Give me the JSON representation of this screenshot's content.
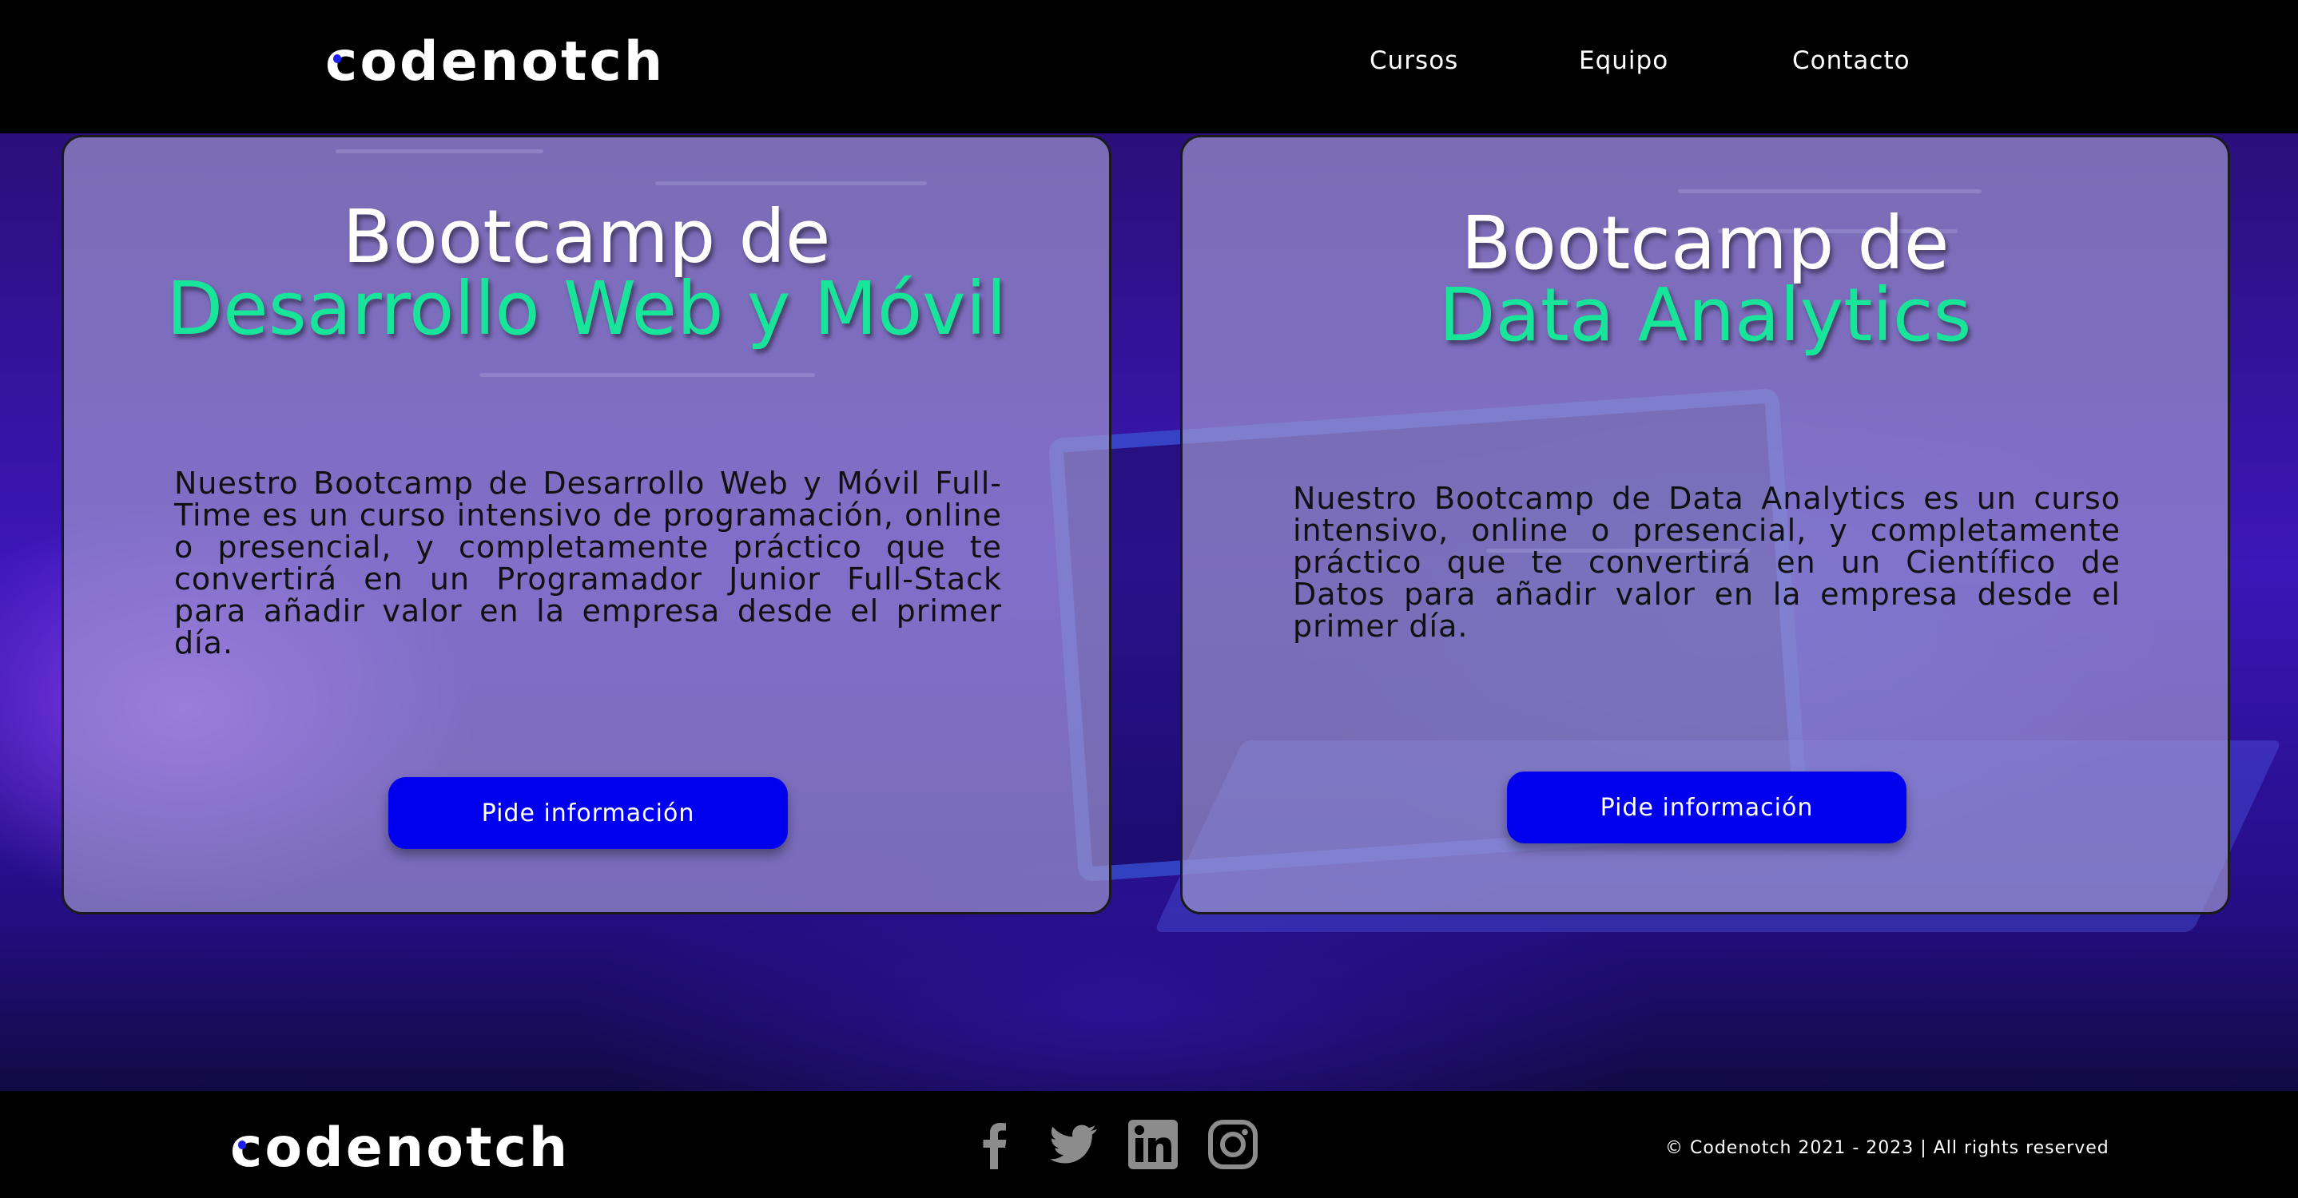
{
  "header": {
    "logo_text": "codenotch",
    "nav": [
      {
        "label": "Cursos"
      },
      {
        "label": "Equipo"
      },
      {
        "label": "Contacto"
      }
    ]
  },
  "cards": [
    {
      "title_line1": "Bootcamp de",
      "title_line2": "Desarrollo Web y Móvil",
      "description": "Nuestro Bootcamp de Desarrollo Web y Móvil Full-Time es un curso intensivo de programación, online o presencial, y completamente práctico que te convertirá en un Programador Junior Full-Stack para añadir valor en la empresa desde el primer día.",
      "button_label": "Pide información"
    },
    {
      "title_line1": "Bootcamp de",
      "title_line2": "Data Analytics",
      "description": "Nuestro Bootcamp de Data Analytics es un curso intensivo, online o presencial, y completamente práctico que te convertirá en un Científico de Datos para añadir valor en la empresa desde el primer día.",
      "button_label": "Pide información"
    }
  ],
  "footer": {
    "logo_text": "codenotch",
    "social_icons": [
      "facebook-icon",
      "twitter-icon",
      "linkedin-icon",
      "instagram-icon"
    ],
    "copyright": "© Codenotch 2021 - 2023 | All rights reserved"
  },
  "colors": {
    "accent_green": "#18e59a",
    "button_blue": "#0000ee",
    "logo_dot_blue": "#1e1ef0",
    "bar_black": "#000000"
  }
}
